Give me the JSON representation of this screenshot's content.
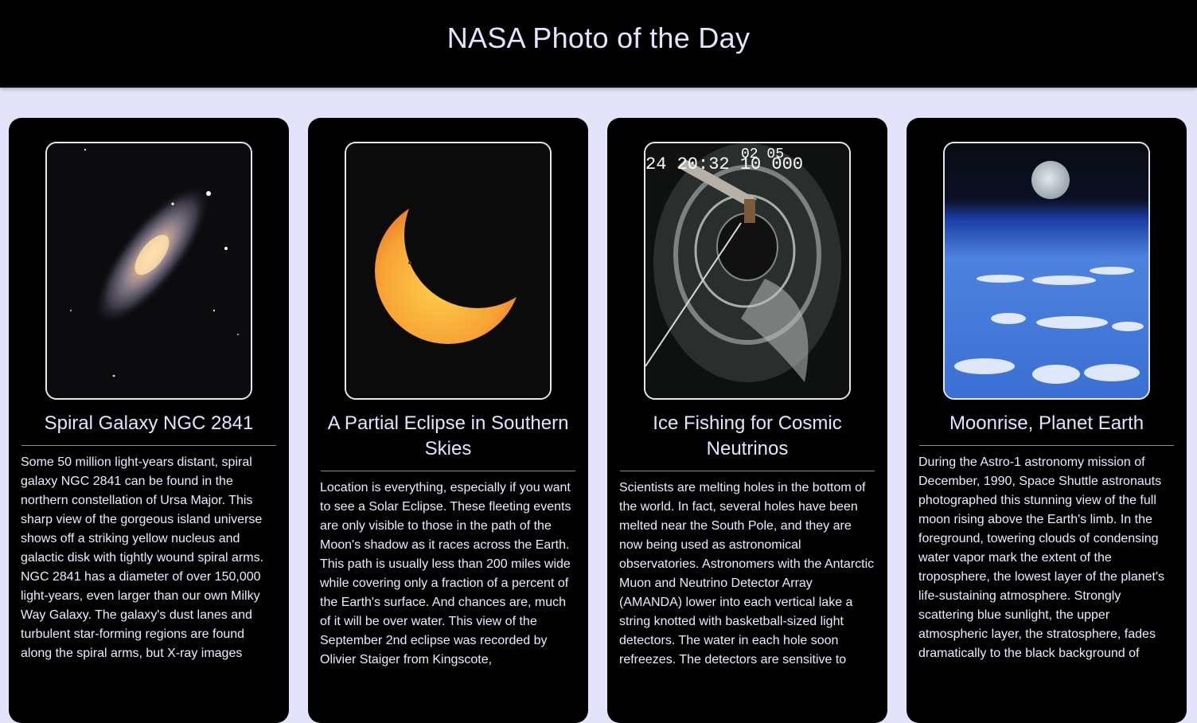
{
  "header": {
    "title": "NASA Photo of the Day"
  },
  "cards": [
    {
      "title": "Spiral Galaxy NGC 2841",
      "icon": "galaxy-photo",
      "description": "Some 50 million light-years distant, spiral galaxy NGC 2841 can be found in the northern constellation of Ursa Major. This sharp view of the gorgeous island universe shows off a striking yellow nucleus and galactic disk with tightly wound spiral arms. NGC 2841 has a diameter of over 150,000 light-years, even larger than our own Milky Way Galaxy. The galaxy's dust lanes and turbulent star-forming regions are found along the spiral arms, but X-ray images"
    },
    {
      "title": "A Partial Eclipse in Southern Skies",
      "icon": "eclipse-photo",
      "description": "Location is everything, especially if you want to see a Solar Eclipse. These fleeting events are only visible to those in the path of the Moon's shadow as it races across the Earth. This path is usually less than 200 miles wide while covering only a fraction of a percent of the Earth's surface. And chances are, much of it will be over water. This view of the September 2nd eclipse was recorded by Olivier Staiger from Kingscote,"
    },
    {
      "title": "Ice Fishing for Cosmic Neutrinos",
      "icon": "borehole-camera-photo",
      "overlay_text": "24 20:32 10 000",
      "overlay_text_top": "02 05",
      "description": "Scientists are melting holes in the bottom of the world. In fact, several holes have been melted near the South Pole, and they are now being used as astronomical observatories. Astronomers with the Antarctic Muon and Neutrino Detector Array (AMANDA) lower into each vertical lake a string knotted with basketball-sized light detectors. The water in each hole soon refreezes. The detectors are sensitive to"
    },
    {
      "title": "Moonrise, Planet Earth",
      "icon": "moonrise-photo",
      "description": "During the Astro-1 astronomy mission of December, 1990, Space Shuttle astronauts photographed this stunning view of the full moon rising above the Earth's limb. In the foreground, towering clouds of condensing water vapor mark the extent of the troposphere, the lowest layer of the planet's life-sustaining atmosphere. Strongly scattering blue sunlight, the upper atmospheric layer, the stratosphere, fades dramatically to the black background of"
    }
  ]
}
